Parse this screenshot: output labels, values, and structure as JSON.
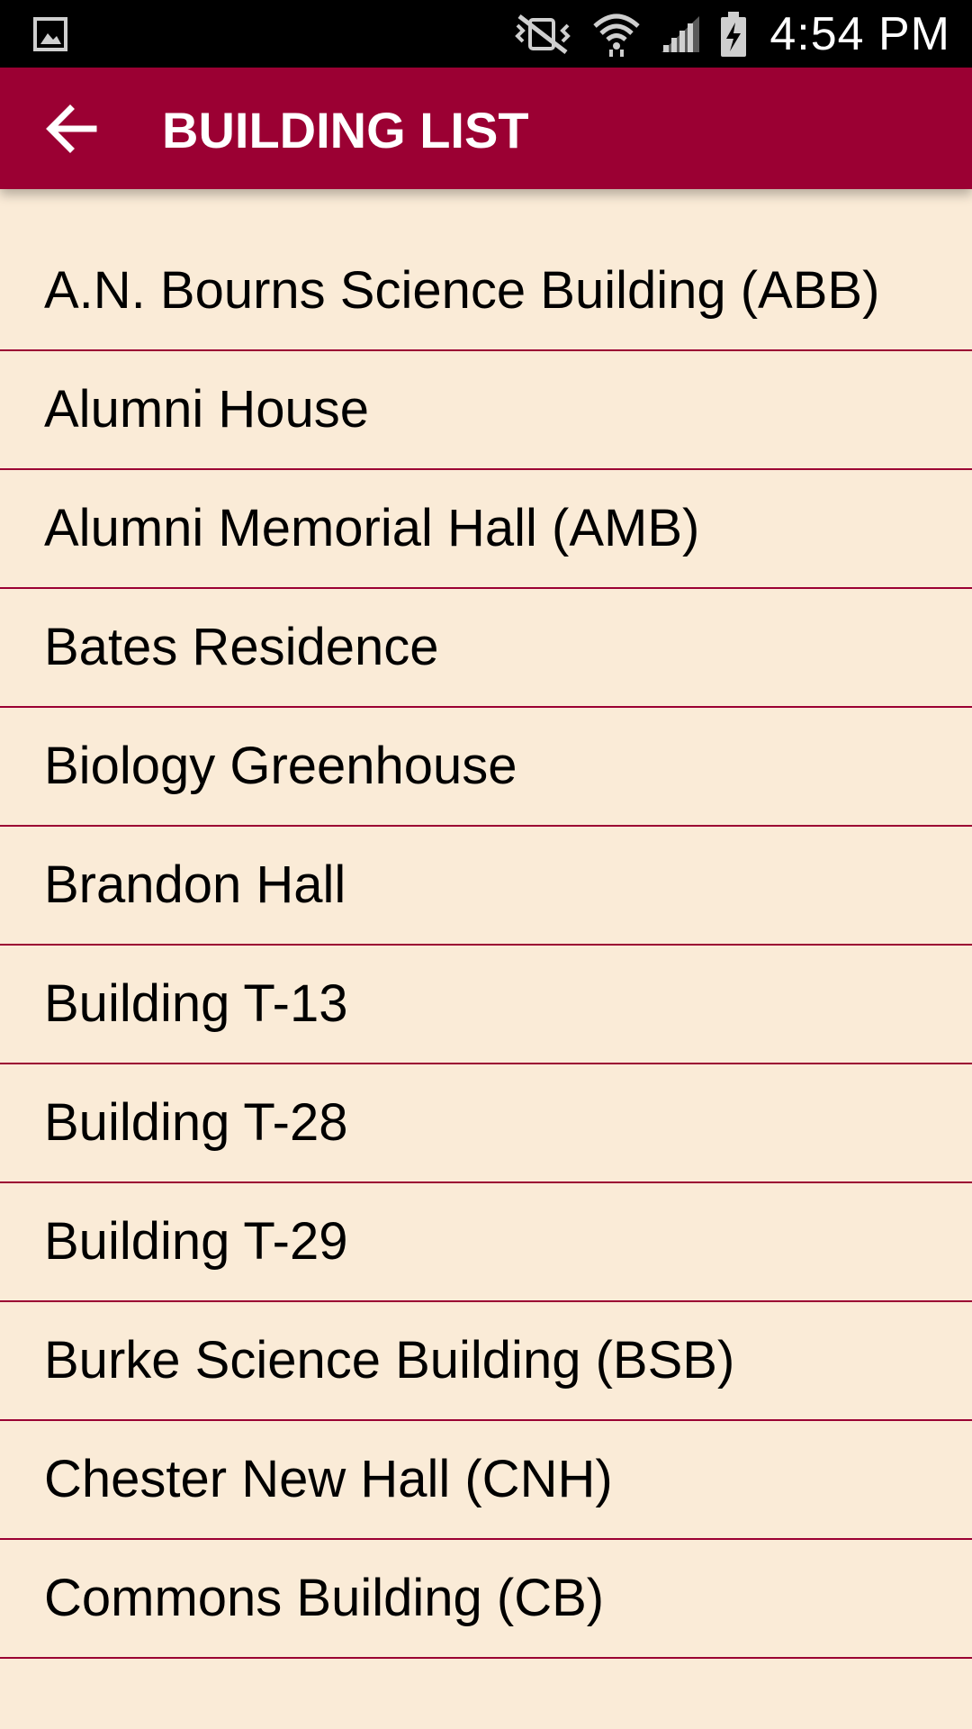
{
  "status_bar": {
    "time": "4:54 PM",
    "icons": [
      "gallery-icon",
      "mute-vibrate-icon",
      "wifi-icon",
      "cell-signal-icon",
      "battery-icon"
    ]
  },
  "app_bar": {
    "title": "BUILDING LIST",
    "back_icon": "arrow-left-icon"
  },
  "colors": {
    "primary": "#9b0033",
    "background": "#faebd7",
    "status_bar": "#000000"
  },
  "buildings": [
    "A.N. Bourns Science Building (ABB)",
    "Alumni House",
    "Alumni Memorial Hall (AMB)",
    "Bates Residence",
    "Biology Greenhouse",
    "Brandon Hall",
    "Building T-13",
    "Building T-28",
    "Building T-29",
    "Burke Science Building (BSB)",
    "Chester New Hall (CNH)",
    "Commons Building (CB)"
  ]
}
